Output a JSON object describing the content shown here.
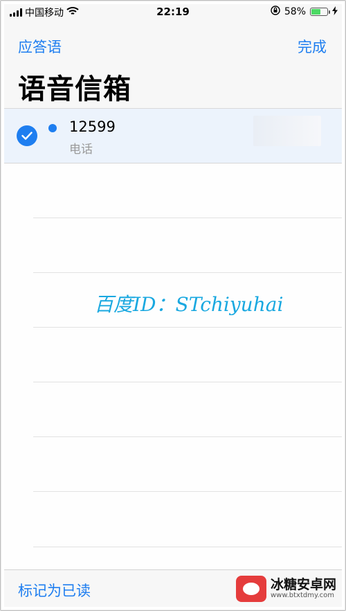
{
  "status_bar": {
    "carrier": "中国移动",
    "time": "22:19",
    "battery_percent_text": "58%",
    "battery_level": 0.58
  },
  "nav": {
    "left_label": "应答语",
    "right_label": "完成",
    "title": "语音信箱"
  },
  "list": {
    "items": [
      {
        "number": "12599",
        "subtitle": "电话",
        "selected": true,
        "unread": true
      }
    ]
  },
  "watermark": "百度ID：STchiyuhai",
  "toolbar": {
    "mark_read_label": "标记为已读"
  },
  "site_badge": {
    "title": "冰糖安卓网",
    "url": "www.btxtdmy.com"
  },
  "colors": {
    "accent": "#1e7ef0",
    "selected_row": "#ecf3fc",
    "watermark": "#19a8e0",
    "battery_fill": "#4cd964"
  }
}
